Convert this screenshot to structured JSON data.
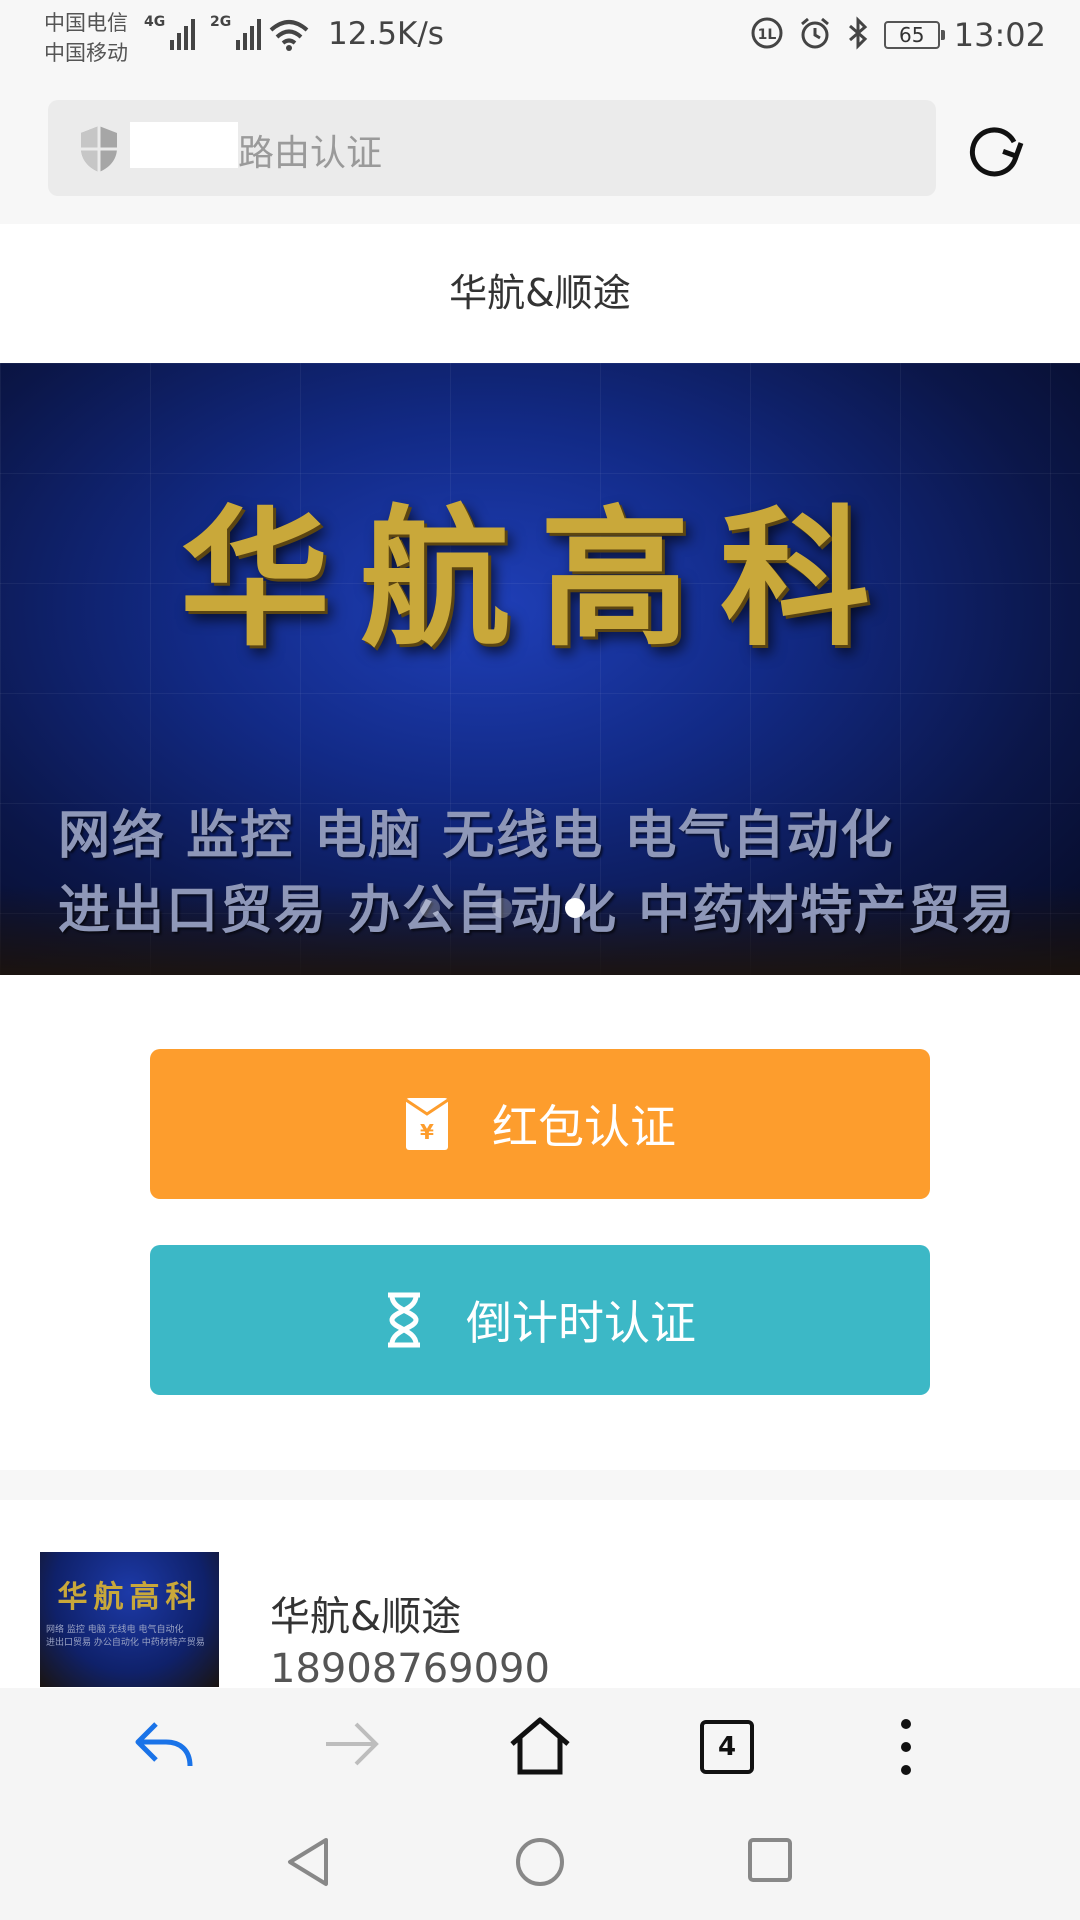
{
  "status_bar": {
    "carrier_1": "中国电信",
    "carrier_2": "中国移动",
    "signal_1_gen": "4G",
    "signal_2_gen": "2G",
    "net_speed": "12.5K/s",
    "battery_level": "65",
    "time": "13:02"
  },
  "address_bar": {
    "url_text": "路由认证",
    "security_icon": "shield-icon",
    "reload_icon": "reload-icon"
  },
  "page": {
    "title": "华航&顺途"
  },
  "banner": {
    "sign_main": "华航高科",
    "sign_line_1": "网络 监控 电脑 无线电 电气自动化",
    "sign_line_2": "进出口贸易 办公自动化 中药材特产贸易",
    "carousel_active_index": 2,
    "carousel_count": 3
  },
  "auth_buttons": {
    "red_packet_label": "红包认证",
    "countdown_label": "倒计时认证",
    "red_packet_color": "#fd9d2d",
    "countdown_color": "#3cb8c6"
  },
  "shop": {
    "name": "华航&顺途",
    "phone": "18908769090",
    "thumb_title": "华航高科",
    "thumb_sub_1": "网络 监控 电脑 无线电 电气自动化",
    "thumb_sub_2": "进出口贸易 办公自动化 中药材特产贸易"
  },
  "browser_toolbar": {
    "back_icon": "back-arrow-icon",
    "forward_icon": "forward-arrow-icon",
    "home_icon": "home-icon",
    "tab_count": "4",
    "menu_icon": "more-vertical-icon",
    "accent_color": "#1a73e8"
  },
  "system_nav": {
    "back": "triangle-back-icon",
    "home": "circle-home-icon",
    "recents": "square-recents-icon"
  }
}
